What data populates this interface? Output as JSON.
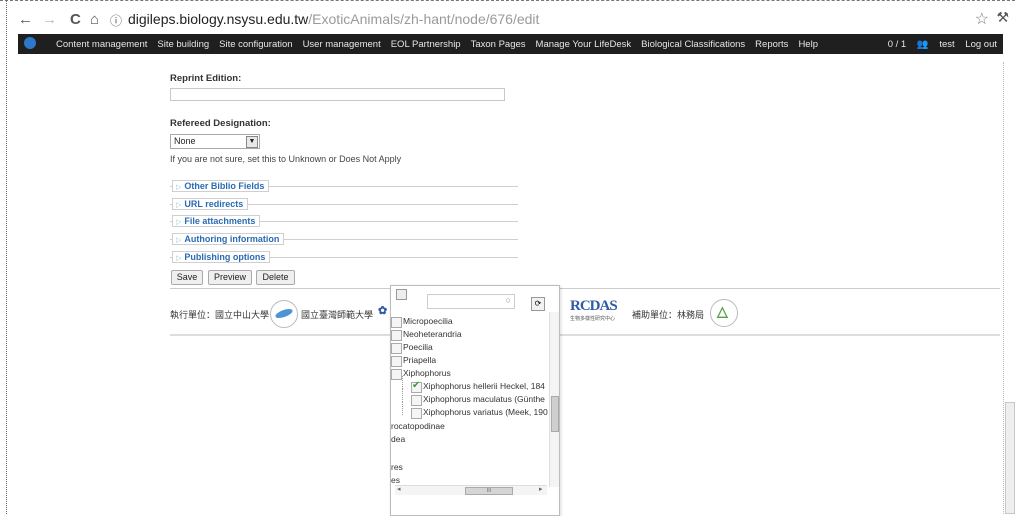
{
  "browser": {
    "back": "←",
    "forward": "→",
    "reload": "C",
    "home": "ñ",
    "url_host": "digileps.biology.nsysu.edu.tw",
    "url_path": "/ExoticAnimals/zh-hant/node/676/edit",
    "star": "☆",
    "wrench": "🔧"
  },
  "adminbar": {
    "menu": [
      "Content management",
      "Site building",
      "Site configuration",
      "User management",
      "EOL Partnership",
      "Taxon Pages",
      "Manage Your LifeDesk",
      "Biological Classifications",
      "Reports",
      "Help"
    ],
    "counter": "0 / 1",
    "user": "test",
    "logout": "Log out"
  },
  "form": {
    "reprint_label": "Reprint Edition:",
    "refereed_label": "Refereed Designation:",
    "refereed_value": "None",
    "help_text": "If you are not sure, set this to Unknown or Does Not Apply",
    "fieldsets": [
      "Other Biblio Fields",
      "URL redirects",
      "File attachments",
      "Authoring information",
      "Publishing options"
    ],
    "buttons": [
      "Save",
      "Preview",
      "Delete"
    ]
  },
  "footer": {
    "exec_label": "執行單位：國立中山大學",
    "partner": "國立臺灣師範大學",
    "rcdas": "RCDAS",
    "rcdas_small": "生物多樣性研究中心",
    "funding_label": "補助單位：林務局"
  },
  "popup": {
    "tree_items": [
      {
        "label": "Micropoecilia",
        "checked": false
      },
      {
        "label": "Neoheterandria",
        "checked": false
      },
      {
        "label": "Poecilia",
        "checked": false
      },
      {
        "label": "Priapella",
        "checked": false
      },
      {
        "label": "Xiphophorus",
        "checked": false
      },
      {
        "label": "Xiphophorus hellerii Heckel, 184",
        "checked": true
      },
      {
        "label": "Xiphophorus maculatus (Günthe",
        "checked": false
      },
      {
        "label": "Xiphophorus variatus (Meek, 190",
        "checked": false
      }
    ],
    "tail_items": [
      "rocatopodinae",
      "dea",
      "res",
      "es"
    ],
    "hscroll_grip": "III"
  }
}
